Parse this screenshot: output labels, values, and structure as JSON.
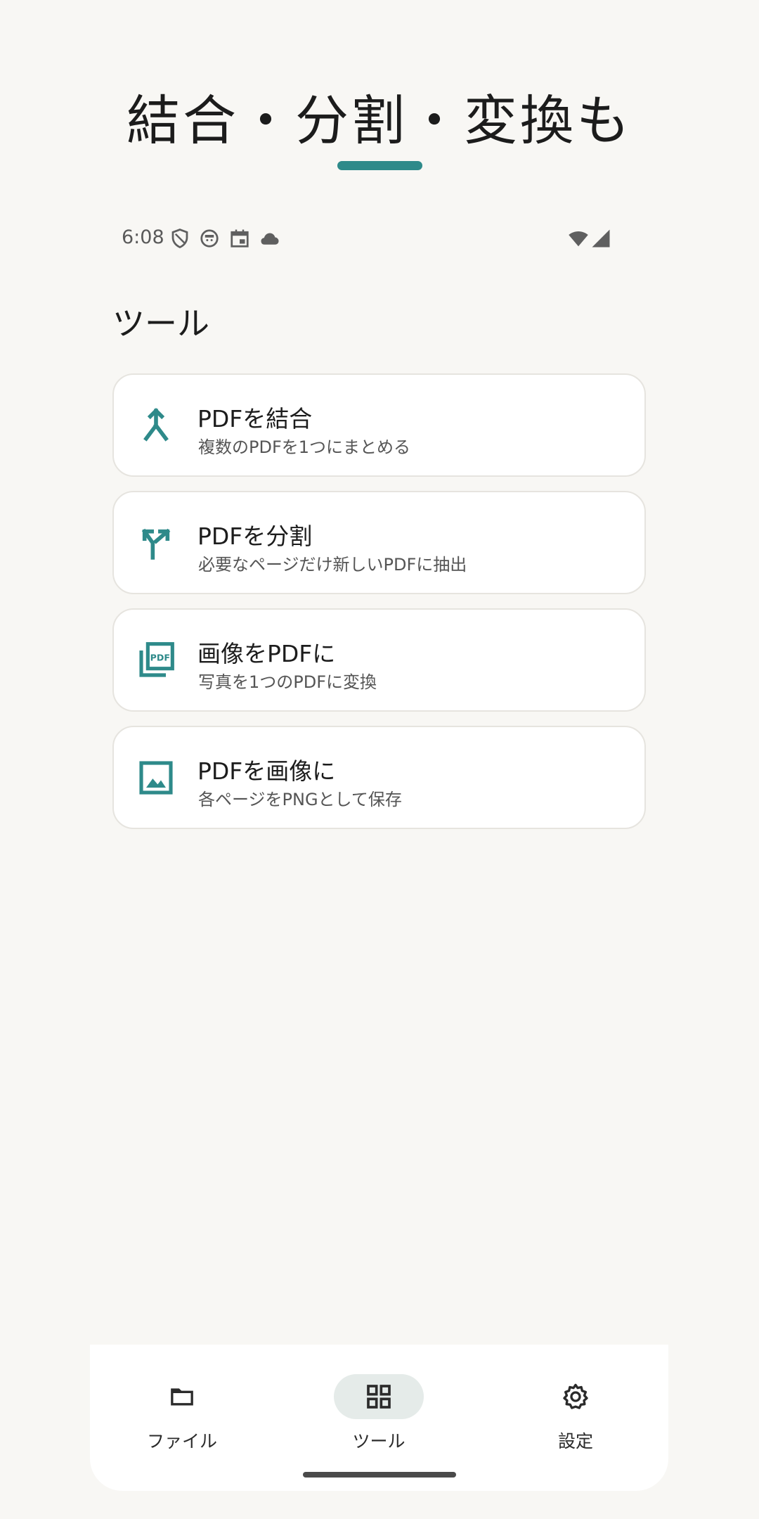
{
  "headline": "結合・分割・変換も",
  "status_bar": {
    "time": "6:08",
    "icons": [
      "shield-icon",
      "face-icon",
      "calendar-icon",
      "cloud-icon",
      "wifi-icon",
      "signal-icon"
    ]
  },
  "section_title": "ツール",
  "tools": [
    {
      "title": "PDFを結合",
      "subtitle": "複数のPDFを1つにまとめる",
      "icon": "merge-icon"
    },
    {
      "title": "PDFを分割",
      "subtitle": "必要なページだけ新しいPDFに抽出",
      "icon": "split-icon"
    },
    {
      "title": "画像をPDFに",
      "subtitle": "写真を1つのPDFに変換",
      "icon": "pdf-stack-icon"
    },
    {
      "title": "PDFを画像に",
      "subtitle": "各ページをPNGとして保存",
      "icon": "image-icon"
    }
  ],
  "bottom_nav": {
    "items": [
      {
        "label": "ファイル",
        "icon": "folder-icon",
        "active": false
      },
      {
        "label": "ツール",
        "icon": "grid-icon",
        "active": true
      },
      {
        "label": "設定",
        "icon": "gear-icon",
        "active": false
      }
    ]
  },
  "colors": {
    "accent": "#2e8a8a",
    "background": "#f8f7f4",
    "card": "#ffffff",
    "nav_active_pill": "#e5ebe9"
  }
}
